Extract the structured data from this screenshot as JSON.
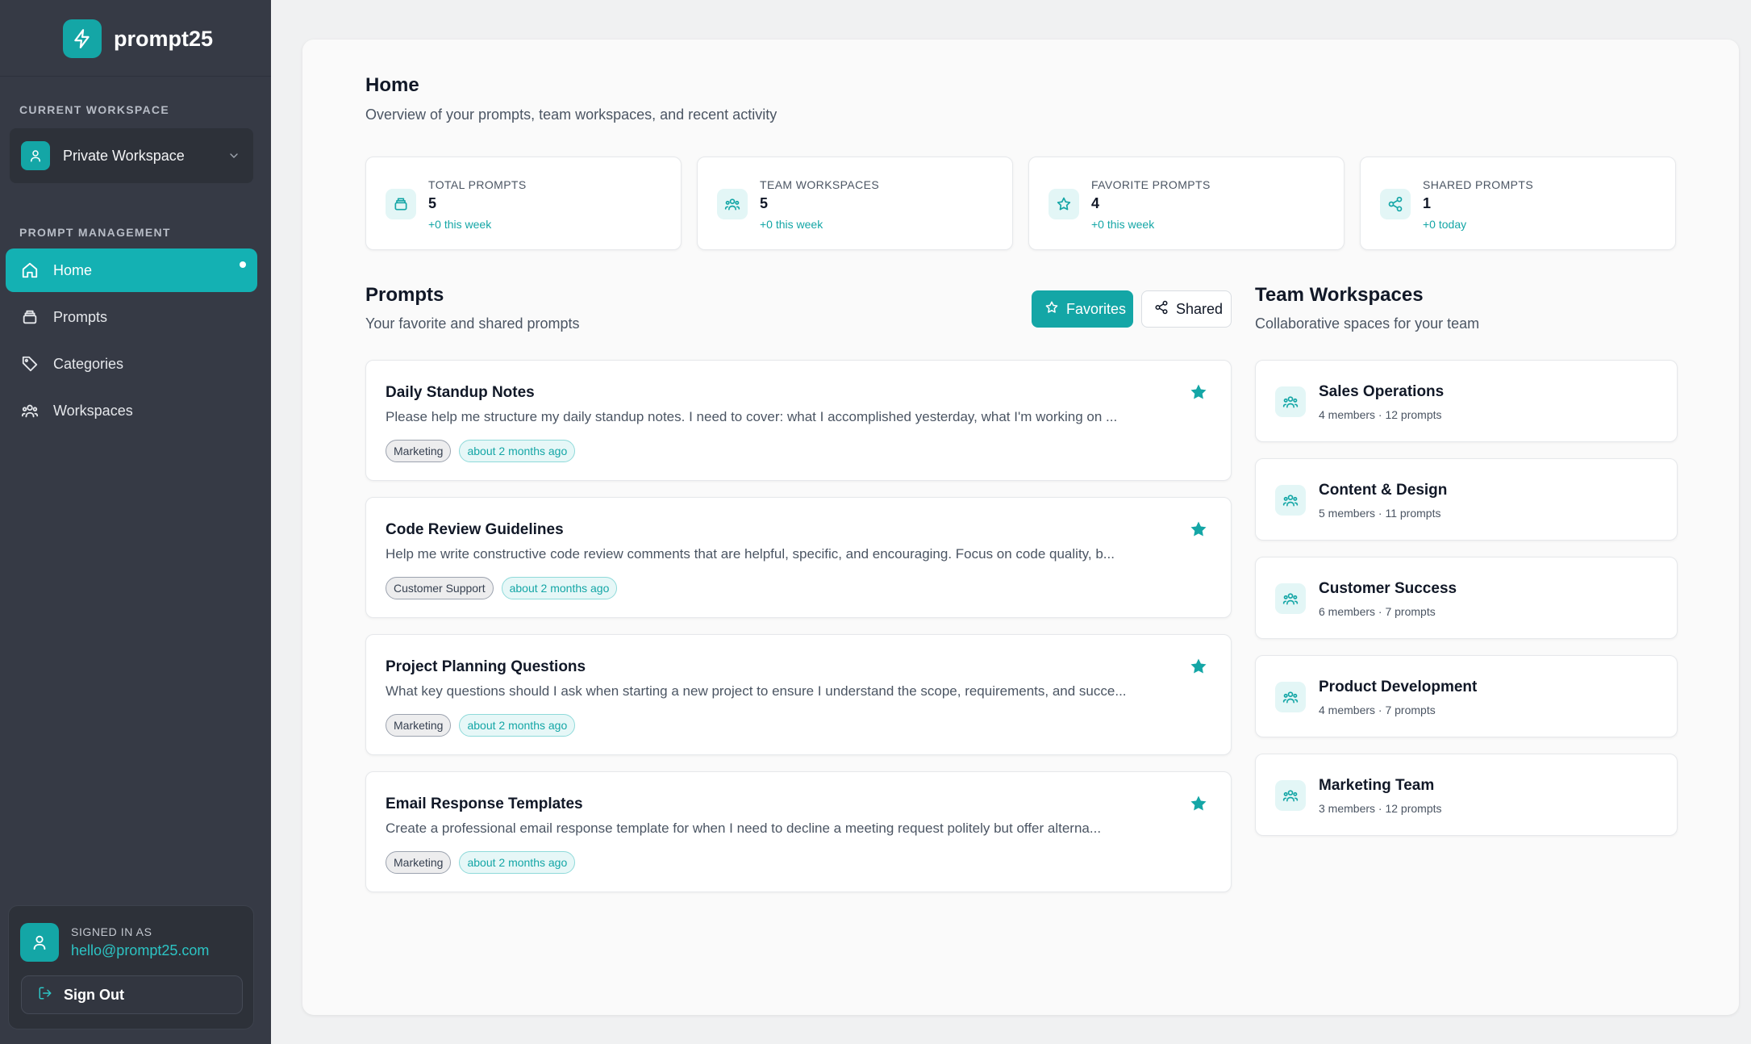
{
  "brand": {
    "name": "prompt25",
    "logo_icon": "lightning-icon"
  },
  "colors": {
    "accent": "#14a6a6",
    "sidebar_bg": "#363a45",
    "active_nav": "#14b1b3"
  },
  "sidebar": {
    "workspace_section_label": "CURRENT WORKSPACE",
    "workspace_name": "Private Workspace",
    "nav_section_label": "PROMPT MANAGEMENT",
    "items": [
      {
        "label": "Home",
        "icon": "home-icon",
        "active": true
      },
      {
        "label": "Prompts",
        "icon": "layers-icon",
        "active": false
      },
      {
        "label": "Categories",
        "icon": "tag-icon",
        "active": false
      },
      {
        "label": "Workspaces",
        "icon": "team-icon",
        "active": false
      }
    ],
    "user": {
      "signed_in_label": "SIGNED IN AS",
      "email": "hello@prompt25.com",
      "signout_label": "Sign Out"
    }
  },
  "main": {
    "title": "Home",
    "subtitle": "Overview of your prompts, team workspaces, and recent activity",
    "stats": [
      {
        "label": "TOTAL PROMPTS",
        "value": "5",
        "delta": "+0 this week",
        "icon": "layers-icon"
      },
      {
        "label": "TEAM WORKSPACES",
        "value": "5",
        "delta": "+0 this week",
        "icon": "team-icon"
      },
      {
        "label": "FAVORITE PROMPTS",
        "value": "4",
        "delta": "+0 this week",
        "icon": "star-icon"
      },
      {
        "label": "SHARED PROMPTS",
        "value": "1",
        "delta": "+0 today",
        "icon": "share-icon"
      }
    ],
    "prompts_section": {
      "title": "Prompts",
      "subtitle": "Your favorite and shared prompts",
      "tabs": [
        {
          "label": "Favorites",
          "icon": "star-outline-icon",
          "active": true
        },
        {
          "label": "Shared",
          "icon": "share-icon",
          "active": false
        }
      ],
      "items": [
        {
          "title": "Daily Standup Notes",
          "description": "Please help me structure my daily standup notes. I need to cover: what I accomplished yesterday, what I'm working on ...",
          "category": "Marketing",
          "time": "about 2 months ago"
        },
        {
          "title": "Code Review Guidelines",
          "description": "Help me write constructive code review comments that are helpful, specific, and encouraging. Focus on code quality, b...",
          "category": "Customer Support",
          "time": "about 2 months ago"
        },
        {
          "title": "Project Planning Questions",
          "description": "What key questions should I ask when starting a new project to ensure I understand the scope, requirements, and succe...",
          "category": "Marketing",
          "time": "about 2 months ago"
        },
        {
          "title": "Email Response Templates",
          "description": "Create a professional email response template for when I need to decline a meeting request politely but offer alterna...",
          "category": "Marketing",
          "time": "about 2 months ago"
        }
      ]
    },
    "teams_section": {
      "title": "Team Workspaces",
      "subtitle": "Collaborative spaces for your team",
      "items": [
        {
          "name": "Sales Operations",
          "meta": "4 members · 12 prompts"
        },
        {
          "name": "Content & Design",
          "meta": "5 members · 11 prompts"
        },
        {
          "name": "Customer Success",
          "meta": "6 members · 7 prompts"
        },
        {
          "name": "Product Development",
          "meta": "4 members · 7 prompts"
        },
        {
          "name": "Marketing Team",
          "meta": "3 members · 12 prompts"
        }
      ]
    }
  }
}
